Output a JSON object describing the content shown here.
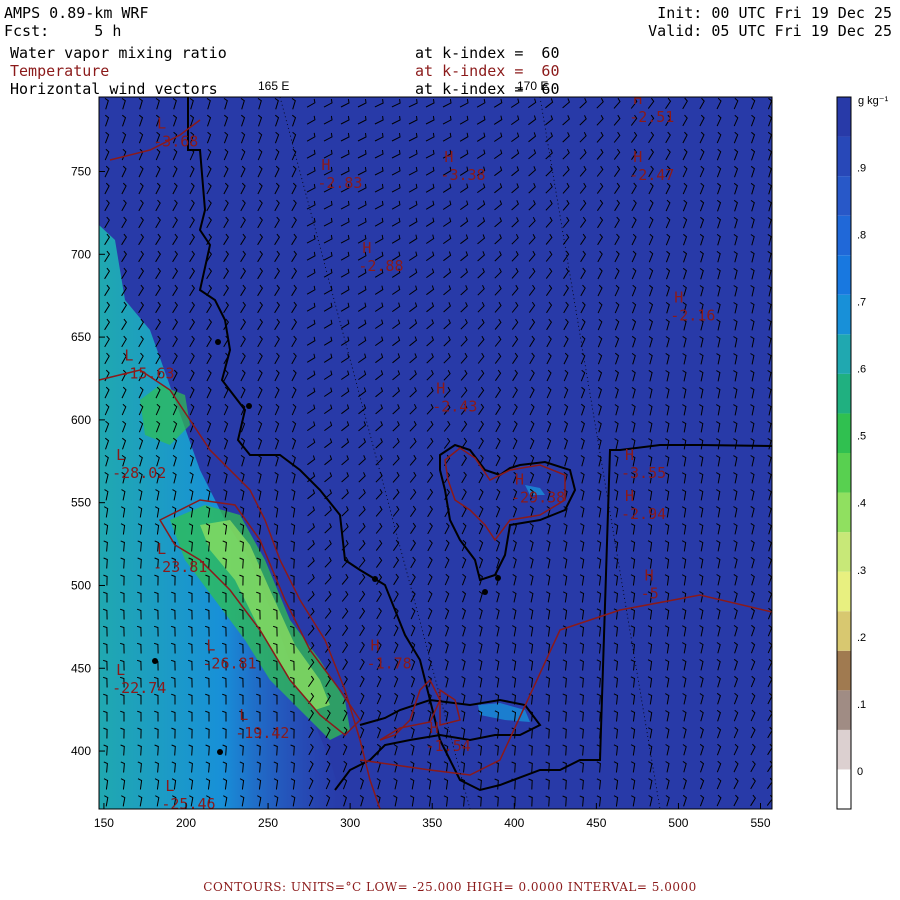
{
  "header": {
    "model": "AMPS 0.89-km WRF",
    "forecast": "Fcst:     5 h",
    "init": "Init: 00 UTC Fri 19 Dec 25",
    "valid": "Valid: 05 UTC Fri 19 Dec 25",
    "fields": [
      {
        "name": "Water vapor mixing ratio",
        "level": "at k-index =  60",
        "color": "#000000"
      },
      {
        "name": "Temperature",
        "level": "at k-index =  60",
        "color": "#8b1a1a"
      },
      {
        "name": "Horizontal wind vectors",
        "level": "at k-index =  60",
        "color": "#000000"
      }
    ],
    "lon_labels": [
      "165 E",
      "170 E"
    ]
  },
  "chart_data": {
    "type": "heatmap",
    "x_ticks": [
      150,
      200,
      250,
      300,
      350,
      400,
      450,
      500,
      550
    ],
    "y_ticks": [
      400,
      450,
      500,
      550,
      600,
      650,
      700,
      750
    ],
    "xlim": [
      147,
      557
    ],
    "ylim": [
      365,
      795
    ],
    "colorbar": {
      "unit": "g kg⁻¹",
      "tick_labels": [
        "0",
        ".1",
        ".2",
        ".3",
        ".4",
        ".5",
        ".6",
        ".7",
        ".8",
        ".9"
      ],
      "colors": [
        "#ffffff",
        "#dcd0d0",
        "#a08c84",
        "#a07a50",
        "#d8c870",
        "#e8f080",
        "#c8e878",
        "#90e060",
        "#58d050",
        "#30c050",
        "#20b080",
        "#20a8b0",
        "#1890d8",
        "#1878e0",
        "#2068d8",
        "#2858c8",
        "#2848b8",
        "#283aa8"
      ]
    },
    "field_base_color": "#283aa8",
    "temperature_labels": [
      {
        "text": "-2.51",
        "x": 470,
        "y": 780
      },
      {
        "text": "-2.47",
        "x": 470,
        "y": 745
      },
      {
        "text": "-2.83",
        "x": 280,
        "y": 740
      },
      {
        "text": "-3.38",
        "x": 355,
        "y": 745
      },
      {
        "text": "-2.88",
        "x": 305,
        "y": 690
      },
      {
        "text": "-2.16",
        "x": 495,
        "y": 660
      },
      {
        "text": "-2.43",
        "x": 350,
        "y": 605
      },
      {
        "text": "-3.55",
        "x": 465,
        "y": 565
      },
      {
        "text": "-2.94",
        "x": 465,
        "y": 540
      },
      {
        "text": "-29.38",
        "x": 398,
        "y": 550
      },
      {
        "text": "-3.68",
        "x": 180,
        "y": 765
      },
      {
        "text": "-15.63",
        "x": 160,
        "y": 625
      },
      {
        "text": "-28.02",
        "x": 155,
        "y": 565
      },
      {
        "text": "-23.81",
        "x": 180,
        "y": 508
      },
      {
        "text": "-26.81",
        "x": 210,
        "y": 450
      },
      {
        "text": "-22.74",
        "x": 155,
        "y": 435
      },
      {
        "text": "-19.42",
        "x": 230,
        "y": 408
      },
      {
        "text": "-25.46",
        "x": 185,
        "y": 365
      },
      {
        "text": "-1.78",
        "x": 310,
        "y": 450
      },
      {
        "text": "-1.54",
        "x": 346,
        "y": 400
      },
      {
        "text": "-5",
        "x": 477,
        "y": 492
      }
    ],
    "footer": "CONTOURS:  UNITS=°C  LOW= -25.000     HIGH=  0.0000     INTERVAL=   5.0000"
  }
}
